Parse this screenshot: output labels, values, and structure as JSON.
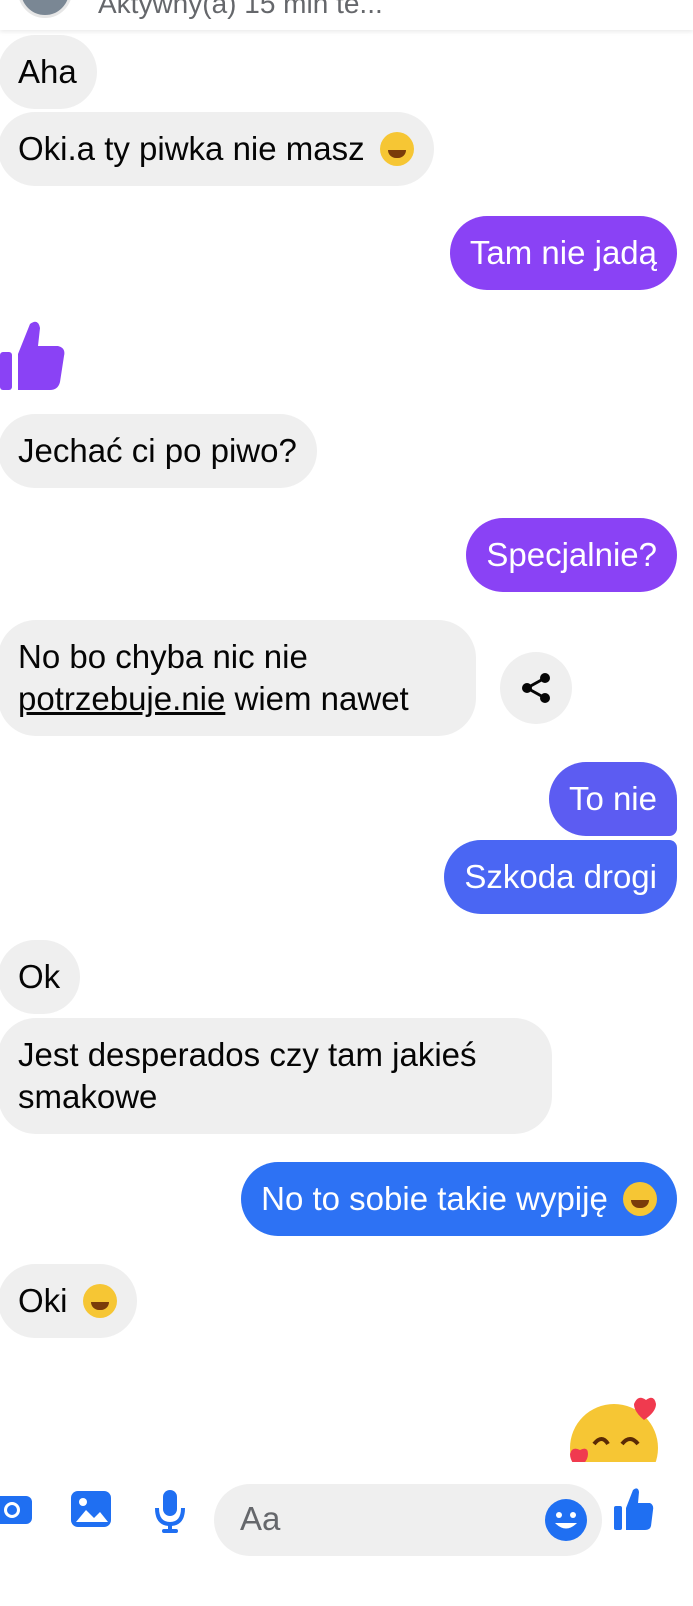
{
  "header": {
    "status": "Aktywny(a) 15 min te..."
  },
  "messages": [
    {
      "text": "Aha"
    },
    {
      "text": "Oki.a ty piwka nie masz"
    },
    {
      "text": "Tam nie jadą"
    },
    {
      "text": "Jechać ci po piwo?"
    },
    {
      "text": "Specjalnie?"
    },
    {
      "link": "potrzebuje.nie",
      "line1": "No bo chyba nic nie",
      "rest": " wiem nawet"
    },
    {
      "text": "To nie"
    },
    {
      "text": "Szkoda drogi"
    },
    {
      "text": "Ok"
    },
    {
      "text": "Jest desperados czy tam jakieś smakowe"
    },
    {
      "text": "No to sobie takie wypiję"
    },
    {
      "text": "Oki"
    }
  ],
  "composer": {
    "placeholder": "Aa"
  },
  "colors": {
    "purple": "#8a42f5",
    "blue": "#2d72f4",
    "incoming": "#efefef",
    "icon_blue": "#1f6ff2"
  }
}
